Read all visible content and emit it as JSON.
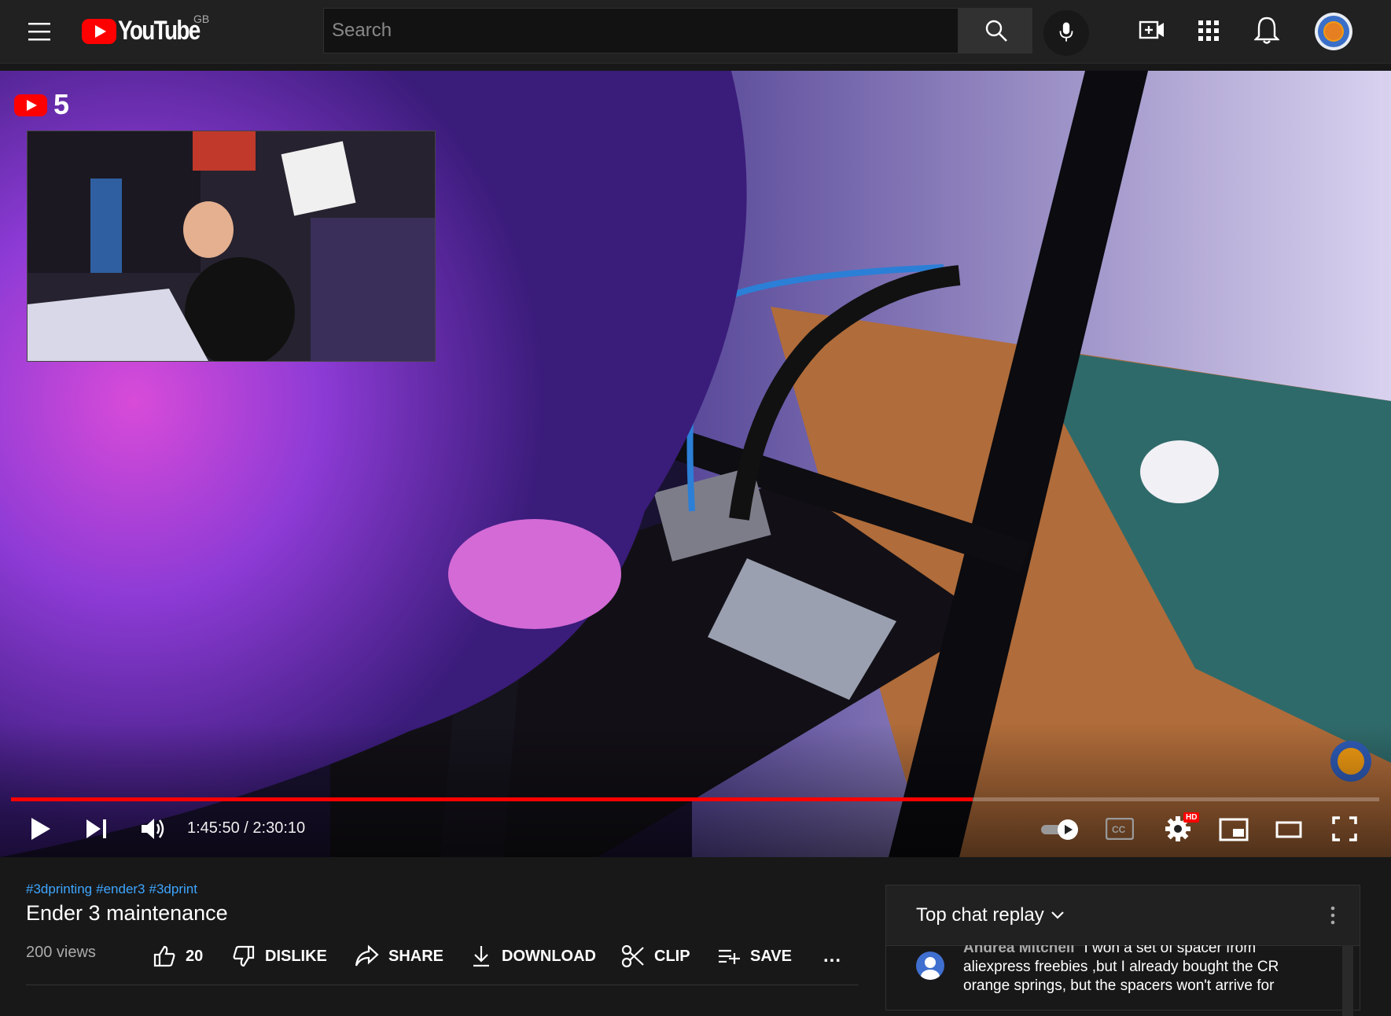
{
  "masthead": {
    "logo_text": "YouTube",
    "country_code": "GB",
    "search_placeholder": "Search"
  },
  "player": {
    "channel_badge_number": "5",
    "time_current": "1:45:50",
    "time_separator": " / ",
    "time_total": "2:30:10",
    "progress_fraction": 0.703,
    "hd_badge": "HD"
  },
  "video": {
    "hashtags": [
      "#3dprinting",
      "#ender3",
      "#3dprint"
    ],
    "title": "Ender 3 maintenance",
    "views": "200 views"
  },
  "actions": {
    "like_count": "20",
    "dislike_label": "DISLIKE",
    "share_label": "SHARE",
    "download_label": "DOWNLOAD",
    "clip_label": "CLIP",
    "save_label": "SAVE",
    "more_label": "..."
  },
  "chat": {
    "title": "Top chat replay",
    "message": {
      "author": "Andrea Mitchell",
      "text": "I won a set of spacer from aliexpress freebies ,but I already bought the CR orange springs, but the spacers won't arrive for"
    }
  },
  "colors": {
    "accent_red": "#ff0000",
    "link_blue": "#3ea6ff",
    "bg": "#181818",
    "masthead_bg": "#212121"
  },
  "icons": [
    "menu-icon",
    "youtube-logo-icon",
    "search-icon",
    "mic-icon",
    "create-video-icon",
    "apps-icon",
    "bell-icon",
    "avatar-icon",
    "play-icon",
    "next-icon",
    "volume-icon",
    "autoplay-icon",
    "cc-icon",
    "settings-icon",
    "miniplayer-icon",
    "theater-icon",
    "fullscreen-icon",
    "like-icon",
    "dislike-icon",
    "share-icon",
    "download-icon",
    "clip-icon",
    "save-icon",
    "chevron-down-icon",
    "more-vert-icon"
  ]
}
